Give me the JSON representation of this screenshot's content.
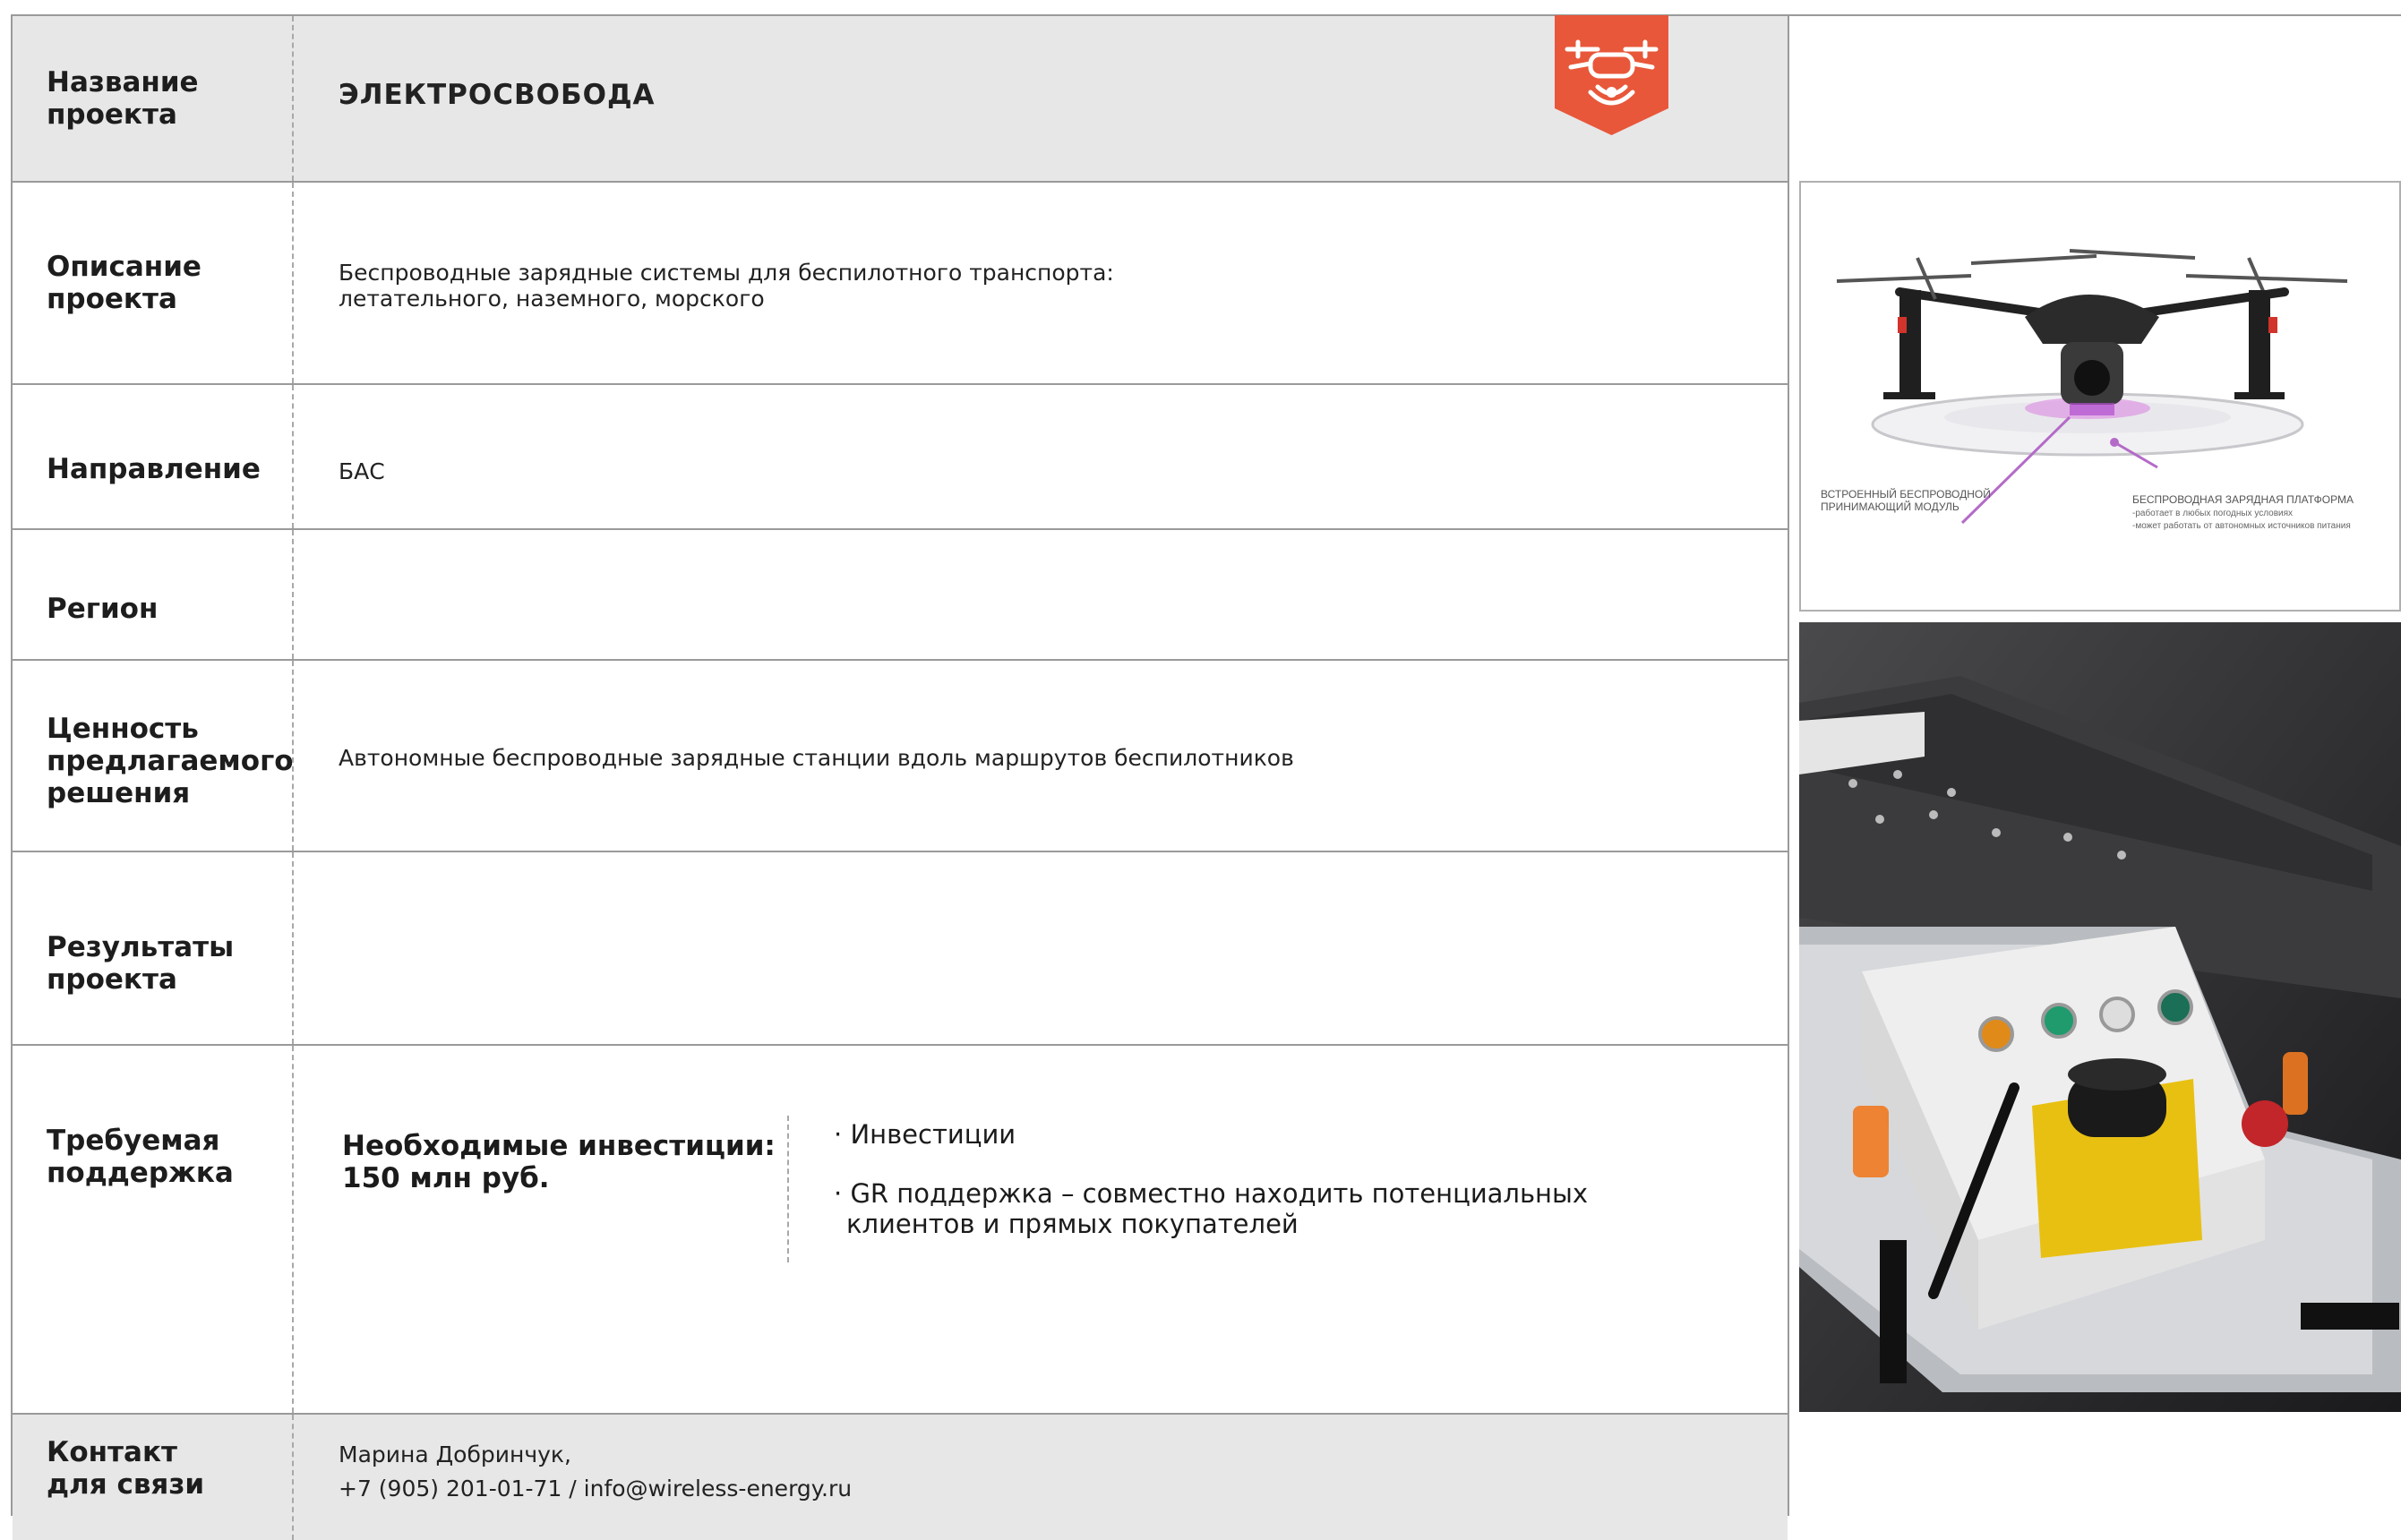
{
  "rows": {
    "name": {
      "label": "Название проекта",
      "value": "ЭЛЕКТРОСВОБОДА"
    },
    "description": {
      "label": "Описание проекта",
      "value_line1": "Беспроводные зарядные системы для беспилотного транспорта:",
      "value_line2": "летательного, наземного, морского"
    },
    "direction": {
      "label": "Направление",
      "value": "БАС"
    },
    "region": {
      "label": "Регион",
      "value": ""
    },
    "value_prop": {
      "label": "Ценность предлагаемого решения",
      "value": "Автономные беспроводные зарядные станции вдоль маршрутов беспилотников"
    },
    "results": {
      "label": "Результаты проекта",
      "value": ""
    },
    "support": {
      "label": "Требуемая поддержка",
      "investment_line1": "Необходимые инвестиции:",
      "investment_line2": "150 млн руб.",
      "items": [
        "Инвестиции",
        "GR поддержка – совместно находить потенциальных клиентов и прямых покупателей"
      ]
    },
    "contact": {
      "label_line1": "Контакт",
      "label_line2": "для связи",
      "name": "Марина Добринчук,",
      "details": "+7 (905) 201-01-71  /  info@wireless-energy.ru"
    }
  },
  "drone_image": {
    "caption_left_1": "ВСТРОЕННЫЙ БЕСПРОВОДНОЙ",
    "caption_left_2": "ПРИНИМАЮЩИЙ МОДУЛЬ",
    "caption_right_1": "БЕСПРОВОДНАЯ ЗАРЯДНАЯ ПЛАТФОРМА",
    "caption_right_2": "-работает в любых погодных условиях",
    "caption_right_3": "-может работать от автономных источников питания"
  },
  "icon": {
    "name": "drone-icon",
    "color": "#e8573a"
  },
  "colors": {
    "header_bg": "#e7e7e8",
    "border": "#9a9a9a",
    "accent": "#e8573a"
  }
}
